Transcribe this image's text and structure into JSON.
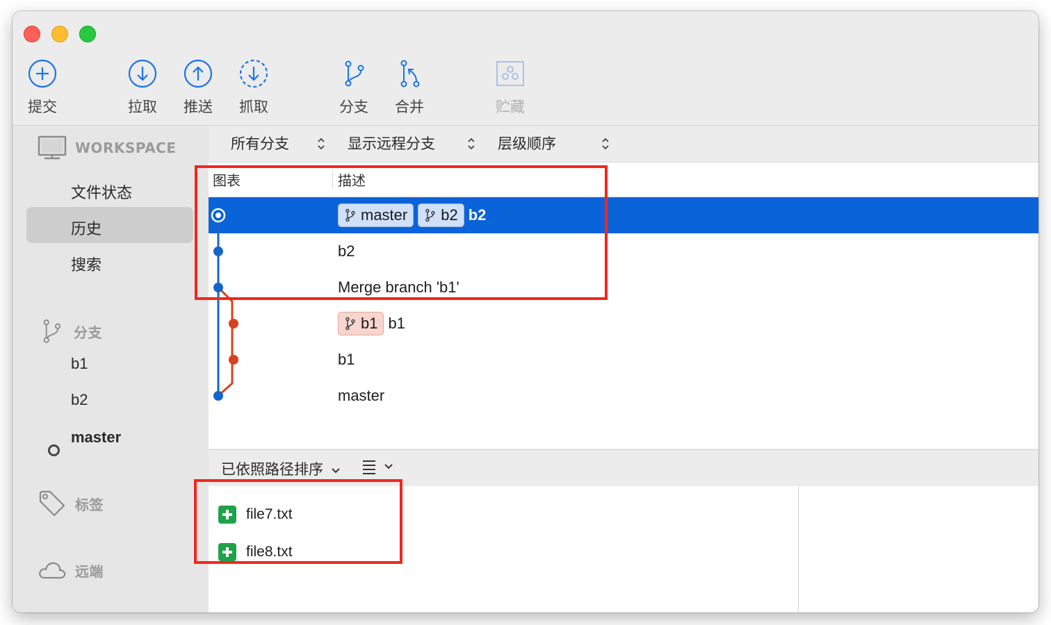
{
  "toolbar": {
    "commit": "提交",
    "pull": "拉取",
    "push": "推送",
    "fetch": "抓取",
    "branch": "分支",
    "merge": "合并",
    "stash": "贮藏"
  },
  "sidebar": {
    "workspace_title": "WORKSPACE",
    "workspace_items": [
      "文件状态",
      "历史",
      "搜索"
    ],
    "branches_title": "分支",
    "branches": [
      "b1",
      "b2",
      "master"
    ],
    "current_branch": "master",
    "tags_title": "标签",
    "remotes_title": "远端"
  },
  "filters": {
    "branches": "所有分支",
    "remote": "显示远程分支",
    "order": "层级顺序"
  },
  "history": {
    "columns": [
      "图表",
      "描述"
    ],
    "rows": [
      {
        "tags": [
          {
            "name": "master",
            "color": "blue"
          },
          {
            "name": "b2",
            "color": "blue"
          }
        ],
        "message": "b2",
        "selected": true
      },
      {
        "tags": [],
        "message": "b2",
        "selected": false
      },
      {
        "tags": [],
        "message": "Merge branch 'b1'",
        "selected": false
      },
      {
        "tags": [
          {
            "name": "b1",
            "color": "red"
          }
        ],
        "message": "b1",
        "selected": false
      },
      {
        "tags": [],
        "message": "b1",
        "selected": false
      },
      {
        "tags": [],
        "message": "master",
        "selected": false
      }
    ]
  },
  "files_panel": {
    "sort_label": "已依照路径排序",
    "files": [
      "file7.txt",
      "file8.txt"
    ]
  },
  "colors": {
    "selection": "#0b63da",
    "graph_blue": "#1565c8",
    "graph_red": "#d9411e",
    "annotation": "#f0281e",
    "file_added": "#1fa34a"
  }
}
